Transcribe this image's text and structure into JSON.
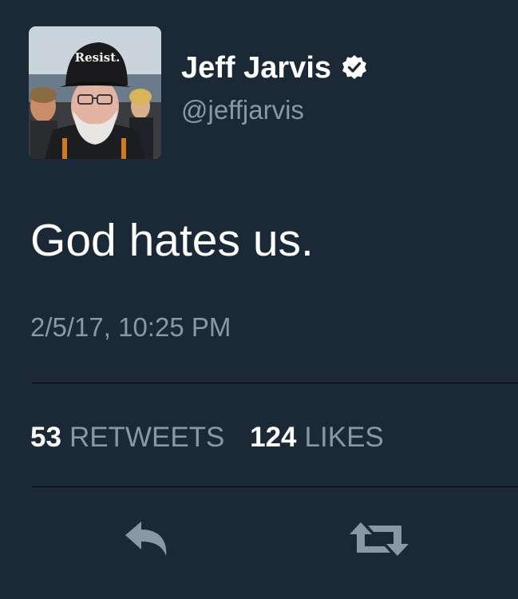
{
  "user": {
    "display_name": "Jeff Jarvis",
    "handle": "@jeffjarvis",
    "verified": true,
    "avatar_icon": "avatar-photo",
    "hat_text": "Resist."
  },
  "tweet": {
    "text": "God hates us.",
    "timestamp": "2/5/17, 10:25 PM"
  },
  "stats": [
    {
      "count": "53",
      "label": "RETWEETS"
    },
    {
      "count": "124",
      "label": "LIKES"
    }
  ],
  "actions": [
    {
      "icon": "reply-icon"
    },
    {
      "icon": "retweet-icon"
    }
  ],
  "colors": {
    "background": "#1b2836",
    "primary_text": "#ffffff",
    "secondary_text": "#8899a6",
    "icon": "#8899a6",
    "divider": "#000000"
  }
}
